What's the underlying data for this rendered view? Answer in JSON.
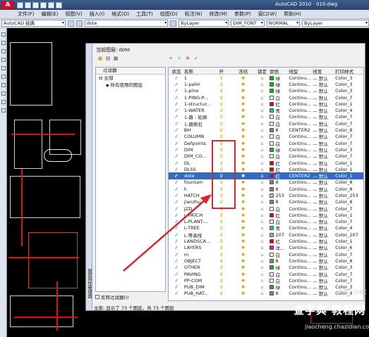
{
  "title_bar": {
    "app_title": "AutoCAD 2010 · 010.dwg"
  },
  "menu": [
    "文件(F)",
    "编辑(E)",
    "视图(V)",
    "插入(I)",
    "格式(O)",
    "工具(T)",
    "绘图(D)",
    "标注(N)",
    "修改(M)",
    "参数(P)",
    "窗口(W)",
    "帮助(H)"
  ],
  "toolbar": {
    "workspace": "AutoCAD 经典",
    "layer": "dote",
    "color": "ByLayer",
    "textstyle": "DIM_FONT",
    "dimstyle": "NORMAL",
    "linetype": "ByLayer"
  },
  "dialog": {
    "current_layer": "当前图层: dote",
    "tree_header": "过滤器",
    "tree_items": [
      "全部",
      "所有使用的图层"
    ],
    "invert_label": "反转过滤器(I)",
    "side_label": "图层特性管理器",
    "columns": [
      "状态",
      "名称",
      "开",
      "冻结",
      "锁定",
      "颜色",
      "线型",
      "线宽",
      "打印样式"
    ],
    "layers": [
      {
        "name": "1",
        "color_name": "绿",
        "color": "#00c000",
        "linetype": "Continu...",
        "lineweight": "— 默认",
        "plot": "Color_3"
      },
      {
        "name": "1-palm",
        "color_name": "绿",
        "color": "#00c000",
        "linetype": "Continu...",
        "lineweight": "— 默认",
        "plot": "Color_3"
      },
      {
        "name": "1-pine",
        "color_name": "绿",
        "color": "#00c000",
        "linetype": "Continu...",
        "lineweight": "— 默认",
        "plot": "Color_3"
      },
      {
        "name": "1-PING-P...",
        "color_name": "白",
        "color": "#ffffff",
        "linetype": "Continu...",
        "lineweight": "— 默认",
        "plot": "Color_7"
      },
      {
        "name": "1-structur...",
        "color_name": "红",
        "color": "#e00000",
        "linetype": "Continu...",
        "lineweight": "— 默认",
        "plot": "Color_1"
      },
      {
        "name": "1-WATER",
        "color_name": "青",
        "color": "#00c0c0",
        "linetype": "Continu...",
        "lineweight": "— 默认",
        "plot": "Color_4"
      },
      {
        "name": "1-路 - 轮廓",
        "color_name": "白",
        "color": "#ffffff",
        "linetype": "Continu...",
        "lineweight": "— 默认",
        "plot": "Color_7"
      },
      {
        "name": "1-路侧石",
        "color_name": "白",
        "color": "#ffffff",
        "linetype": "Continu...",
        "lineweight": "— 默认",
        "plot": "Color_7"
      },
      {
        "name": "BH",
        "color_name": "8",
        "color": "#808080",
        "linetype": "CENTER2",
        "lineweight": "— 默认",
        "plot": "Color_8"
      },
      {
        "name": "COLUMN",
        "color_name": "白",
        "color": "#ffffff",
        "linetype": "Continu...",
        "lineweight": "— 默认",
        "plot": "Color_7"
      },
      {
        "name": "Defpoints",
        "color_name": "白",
        "color": "#ffffff",
        "linetype": "Continu...",
        "lineweight": "— 默认",
        "plot": "Color_7"
      },
      {
        "name": "DIM",
        "color_name": "绿",
        "color": "#00c000",
        "linetype": "Continu...",
        "lineweight": "— 默认",
        "plot": "Color_3"
      },
      {
        "name": "DIM_CO...",
        "color_name": "白",
        "color": "#ffffff",
        "linetype": "Continu...",
        "lineweight": "— 默认",
        "plot": "Color_7"
      },
      {
        "name": "DL",
        "color_name": "红",
        "color": "#e00000",
        "linetype": "Continu...",
        "lineweight": "— 默认",
        "plot": "Color_1"
      },
      {
        "name": "DLSS",
        "color_name": "红",
        "color": "#e00000",
        "linetype": "Continu...",
        "lineweight": "— 默认",
        "plot": "Color_1"
      },
      {
        "name": "dote",
        "color_name": "红",
        "color": "#e00000",
        "linetype": "CENTER2",
        "lineweight": "— 默认",
        "plot": "Color_1"
      },
      {
        "name": "fountain",
        "color_name": "8",
        "color": "#808080",
        "linetype": "Continu...",
        "lineweight": "— 默认",
        "plot": "Color_8"
      },
      {
        "name": "h",
        "color_name": "8",
        "color": "#808080",
        "linetype": "Continu...",
        "lineweight": "— 默认",
        "plot": "Color_8"
      },
      {
        "name": "HATCH",
        "color_name": "253",
        "color": "#bdbdbd",
        "linetype": "Continu...",
        "lineweight": "— 默认",
        "plot": "Color_253"
      },
      {
        "name": "jianzhu",
        "color_name": "8",
        "color": "#808080",
        "linetype": "Continu...",
        "lineweight": "— 默认",
        "plot": "Color_8"
      },
      {
        "name": "JZD",
        "color_name": "白",
        "color": "#ffffff",
        "linetype": "Continu...",
        "lineweight": "— 默认",
        "plot": "Color_7"
      },
      {
        "name": "L-PATCH",
        "color_name": "红",
        "color": "#e00000",
        "linetype": "Continu...",
        "lineweight": "— 默认",
        "plot": "Color_1"
      },
      {
        "name": "L-PLANT-...",
        "color_name": "白",
        "color": "#ffffff",
        "linetype": "Continu...",
        "lineweight": "— 默认",
        "plot": "Color_7"
      },
      {
        "name": "L-TREE",
        "color_name": "青",
        "color": "#00c0c0",
        "linetype": "Continu...",
        "lineweight": "— 默认",
        "plot": "Color_4"
      },
      {
        "name": "L-等高线",
        "color_name": "207",
        "color": "#d080c0",
        "linetype": "Continu...",
        "lineweight": "— 默认",
        "plot": "Color_207"
      },
      {
        "name": "LANDSCA...",
        "color_name": "红",
        "color": "#e00000",
        "linetype": "Continu...",
        "lineweight": "— 默认",
        "plot": "Color_1"
      },
      {
        "name": "LAYERS",
        "color_name": "洋...",
        "color": "#e000e0",
        "linetype": "Continu...",
        "lineweight": "— 默认",
        "plot": "Color_6"
      },
      {
        "name": "m",
        "color_name": "白",
        "color": "#ffffff",
        "linetype": "Continu...",
        "lineweight": "— 默认",
        "plot": "Color_7"
      },
      {
        "name": "OBJECT",
        "color_name": "8",
        "color": "#808080",
        "linetype": "Continu...",
        "lineweight": "— 默认",
        "plot": "Color_8"
      },
      {
        "name": "OTHER",
        "color_name": "绿",
        "color": "#00c000",
        "linetype": "Continu...",
        "lineweight": "— 默认",
        "plot": "Color_3"
      },
      {
        "name": "PAVING",
        "color_name": "白",
        "color": "#ffffff",
        "linetype": "Continu...",
        "lineweight": "— 默认",
        "plot": "Color_7"
      },
      {
        "name": "PP-COM",
        "color_name": "白",
        "color": "#ffffff",
        "linetype": "Continu...",
        "lineweight": "— 默认",
        "plot": "Color_7"
      },
      {
        "name": "PUB_DIM",
        "color_name": "绿",
        "color": "#00c000",
        "linetype": "Continu...",
        "lineweight": "— 默认",
        "plot": "Color_3"
      },
      {
        "name": "PUB_HAT...",
        "color_name": "8",
        "color": "#808080",
        "linetype": "Continu...",
        "lineweight": "— 默认",
        "plot": "Color_8"
      }
    ],
    "status": "全部: 显示了 73 个图层，共 73 个图层"
  },
  "watermark": {
    "site": "ib51.net",
    "title": "查字典 教程网",
    "url": "jiaocheng.chazidian.com"
  }
}
